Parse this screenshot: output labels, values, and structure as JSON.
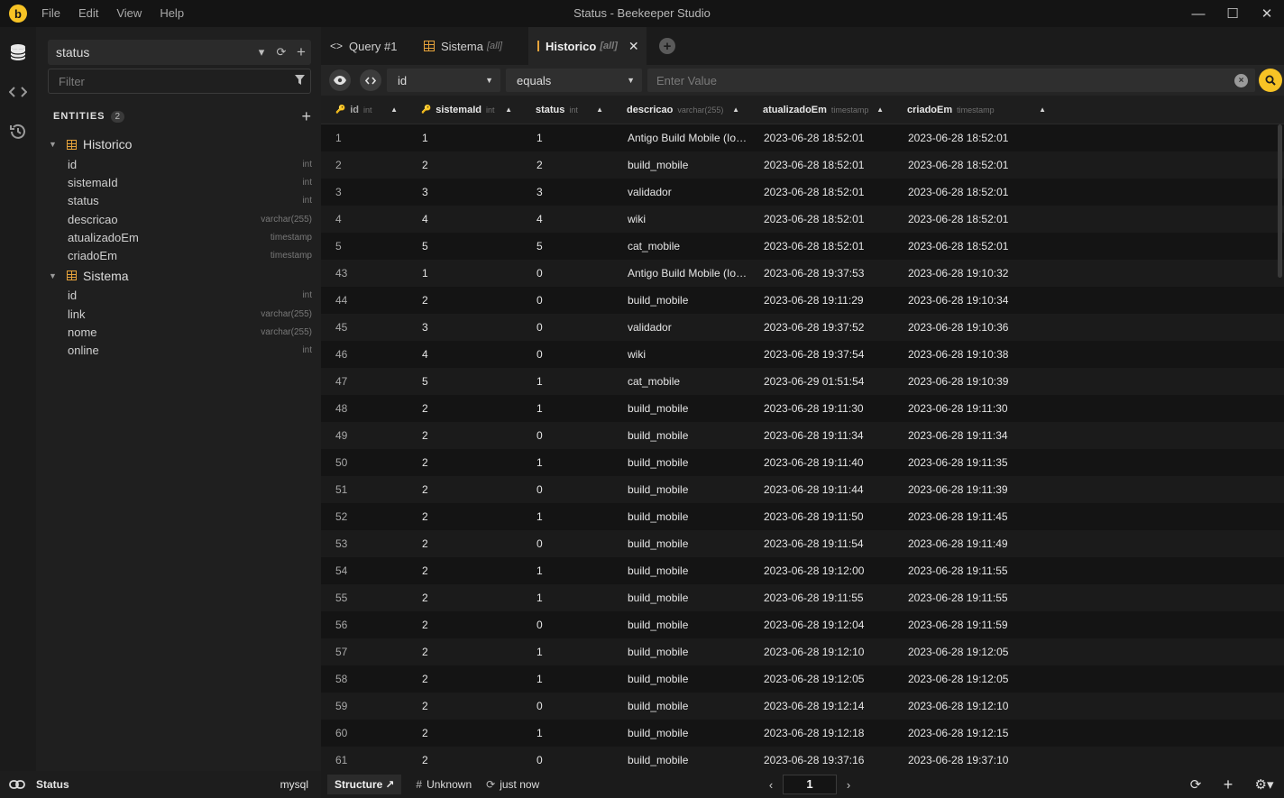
{
  "window": {
    "title": "Status - Beekeeper Studio",
    "logo_letter": "b",
    "menu": [
      "File",
      "Edit",
      "View",
      "Help"
    ],
    "controls": {
      "minimize": "—",
      "maximize": "☐",
      "close": "✕"
    }
  },
  "sidebar": {
    "connection": "status",
    "filter_placeholder": "Filter",
    "entities_label": "ENTITIES",
    "entities_count": "2",
    "tables": [
      {
        "name": "Historico",
        "columns": [
          {
            "name": "id",
            "type": "int"
          },
          {
            "name": "sistemaId",
            "type": "int"
          },
          {
            "name": "status",
            "type": "int"
          },
          {
            "name": "descricao",
            "type": "varchar(255)"
          },
          {
            "name": "atualizadoEm",
            "type": "timestamp"
          },
          {
            "name": "criadoEm",
            "type": "timestamp"
          }
        ]
      },
      {
        "name": "Sistema",
        "columns": [
          {
            "name": "id",
            "type": "int"
          },
          {
            "name": "link",
            "type": "varchar(255)"
          },
          {
            "name": "nome",
            "type": "varchar(255)"
          },
          {
            "name": "online",
            "type": "int"
          }
        ]
      }
    ]
  },
  "tabs": [
    {
      "label": "Query #1",
      "icon": "code-icon",
      "all": "",
      "active": false
    },
    {
      "label": "Sistema",
      "icon": "table-icon",
      "all": "[all]",
      "active": false
    },
    {
      "label": "Historico",
      "icon": "table-icon",
      "all": "[all]",
      "active": true
    }
  ],
  "filter_bar": {
    "column": "id",
    "operator": "equals",
    "value_placeholder": "Enter Value"
  },
  "grid": {
    "columns": [
      {
        "name": "id",
        "type": "int",
        "key": "primary-key-icon"
      },
      {
        "name": "sistemaId",
        "type": "int",
        "key": "foreign-key-icon"
      },
      {
        "name": "status",
        "type": "int",
        "key": ""
      },
      {
        "name": "descricao",
        "type": "varchar(255)",
        "key": ""
      },
      {
        "name": "atualizadoEm",
        "type": "timestamp",
        "key": ""
      },
      {
        "name": "criadoEm",
        "type": "timestamp",
        "key": ""
      }
    ],
    "rows": [
      [
        "1",
        "1",
        "1",
        "Antigo Build Mobile (Ionic)",
        "2023-06-28 18:52:01",
        "2023-06-28 18:52:01"
      ],
      [
        "2",
        "2",
        "2",
        "build_mobile",
        "2023-06-28 18:52:01",
        "2023-06-28 18:52:01"
      ],
      [
        "3",
        "3",
        "3",
        "validador",
        "2023-06-28 18:52:01",
        "2023-06-28 18:52:01"
      ],
      [
        "4",
        "4",
        "4",
        "wiki",
        "2023-06-28 18:52:01",
        "2023-06-28 18:52:01"
      ],
      [
        "5",
        "5",
        "5",
        "cat_mobile",
        "2023-06-28 18:52:01",
        "2023-06-28 18:52:01"
      ],
      [
        "43",
        "1",
        "0",
        "Antigo Build Mobile (Ionic)",
        "2023-06-28 19:37:53",
        "2023-06-28 19:10:32"
      ],
      [
        "44",
        "2",
        "0",
        "build_mobile",
        "2023-06-28 19:11:29",
        "2023-06-28 19:10:34"
      ],
      [
        "45",
        "3",
        "0",
        "validador",
        "2023-06-28 19:37:52",
        "2023-06-28 19:10:36"
      ],
      [
        "46",
        "4",
        "0",
        "wiki",
        "2023-06-28 19:37:54",
        "2023-06-28 19:10:38"
      ],
      [
        "47",
        "5",
        "1",
        "cat_mobile",
        "2023-06-29 01:51:54",
        "2023-06-28 19:10:39"
      ],
      [
        "48",
        "2",
        "1",
        "build_mobile",
        "2023-06-28 19:11:30",
        "2023-06-28 19:11:30"
      ],
      [
        "49",
        "2",
        "0",
        "build_mobile",
        "2023-06-28 19:11:34",
        "2023-06-28 19:11:34"
      ],
      [
        "50",
        "2",
        "1",
        "build_mobile",
        "2023-06-28 19:11:40",
        "2023-06-28 19:11:35"
      ],
      [
        "51",
        "2",
        "0",
        "build_mobile",
        "2023-06-28 19:11:44",
        "2023-06-28 19:11:39"
      ],
      [
        "52",
        "2",
        "1",
        "build_mobile",
        "2023-06-28 19:11:50",
        "2023-06-28 19:11:45"
      ],
      [
        "53",
        "2",
        "0",
        "build_mobile",
        "2023-06-28 19:11:54",
        "2023-06-28 19:11:49"
      ],
      [
        "54",
        "2",
        "1",
        "build_mobile",
        "2023-06-28 19:12:00",
        "2023-06-28 19:11:55"
      ],
      [
        "55",
        "2",
        "1",
        "build_mobile",
        "2023-06-28 19:11:55",
        "2023-06-28 19:11:55"
      ],
      [
        "56",
        "2",
        "0",
        "build_mobile",
        "2023-06-28 19:12:04",
        "2023-06-28 19:11:59"
      ],
      [
        "57",
        "2",
        "1",
        "build_mobile",
        "2023-06-28 19:12:10",
        "2023-06-28 19:12:05"
      ],
      [
        "58",
        "2",
        "1",
        "build_mobile",
        "2023-06-28 19:12:05",
        "2023-06-28 19:12:05"
      ],
      [
        "59",
        "2",
        "0",
        "build_mobile",
        "2023-06-28 19:12:14",
        "2023-06-28 19:12:10"
      ],
      [
        "60",
        "2",
        "1",
        "build_mobile",
        "2023-06-28 19:12:18",
        "2023-06-28 19:12:15"
      ],
      [
        "61",
        "2",
        "0",
        "build_mobile",
        "2023-06-28 19:37:16",
        "2023-06-28 19:37:10"
      ]
    ]
  },
  "statusbar": {
    "connection_name": "Status",
    "connection_type": "mysql",
    "structure_label": "Structure",
    "unknown_label": "Unknown",
    "updated_label": "just now",
    "page": "1"
  },
  "colors": {
    "accent": "#f7c325",
    "table_icon": "#e6a33b"
  }
}
